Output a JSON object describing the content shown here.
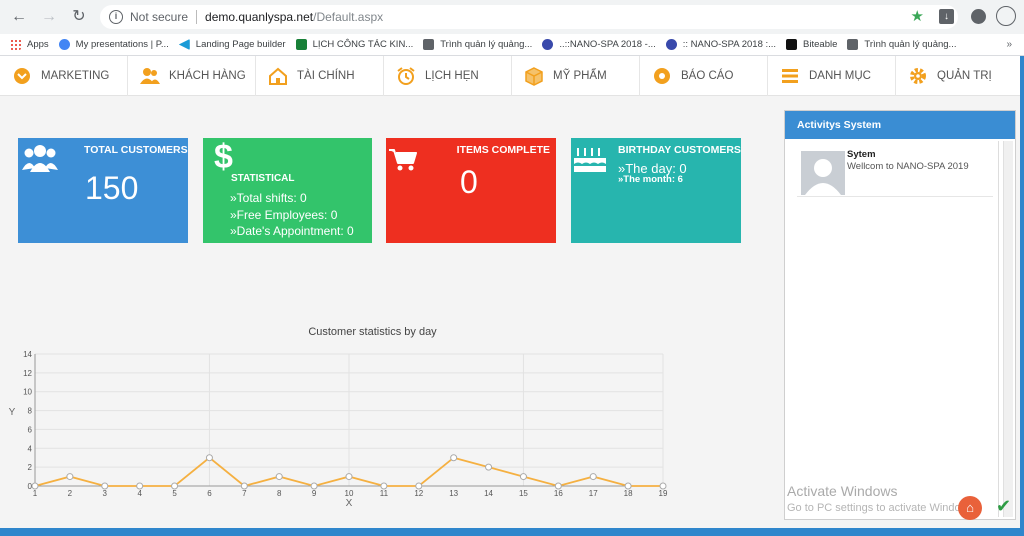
{
  "browser": {
    "security": "Not secure",
    "url_host": "demo.quanlyspa.net",
    "url_path": "/Default.aspx",
    "bookmarks": [
      {
        "label": "Apps",
        "color": "#e94235"
      },
      {
        "label": "My presentations | P...",
        "color": "#4285f4"
      },
      {
        "label": "Landing Page builder",
        "color": "#1a9bd7"
      },
      {
        "label": "LỊCH CÔNG TÁC KIN...",
        "color": "#188038"
      },
      {
        "label": "Trình quản lý quảng...",
        "color": "#5f6368"
      },
      {
        "label": "..::NANO-SPA 2018 -...",
        "color": "#3949ab"
      },
      {
        "label": ":: NANO-SPA 2018 :...",
        "color": "#3949ab"
      },
      {
        "label": "Biteable",
        "color": "#111111"
      },
      {
        "label": "Trình quản lý quảng...",
        "color": "#5f6368"
      }
    ],
    "more": "»"
  },
  "nav": [
    {
      "label": "MARKETING",
      "icon": "marketing-icon",
      "color": "#f2a01e"
    },
    {
      "label": "KHÁCH HÀNG",
      "icon": "customers-icon",
      "color": "#f2a01e"
    },
    {
      "label": "TÀI CHÍNH",
      "icon": "finance-icon",
      "color": "#f2a01e"
    },
    {
      "label": "LỊCH HẸN",
      "icon": "alarm-clock-icon",
      "color": "#f2a01e"
    },
    {
      "label": "MỸ PHẨM",
      "icon": "box-icon",
      "color": "#f2a01e"
    },
    {
      "label": "BÁO CÁO",
      "icon": "report-icon",
      "color": "#f2a01e"
    },
    {
      "label": "DANH MỤC",
      "icon": "list-icon",
      "color": "#f2a01e"
    },
    {
      "label": "QUẢN TRỊ",
      "icon": "gear-icon",
      "color": "#f2a01e"
    }
  ],
  "tiles": {
    "total_customers": {
      "title": "TOTAL CUSTOMERS",
      "value": "150",
      "color": "#3d8fd6"
    },
    "statistical": {
      "title": "STATISTICAL",
      "color": "#33c46b",
      "lines": [
        "»Total shifts: 0",
        "»Free Employees: 0",
        "»Date's Appointment: 0"
      ]
    },
    "items_complete": {
      "title": "ITEMS COMPLETE",
      "value": "0",
      "color": "#ee2f20"
    },
    "birthday": {
      "title": "BIRTHDAY CUSTOMERS",
      "color": "#27b5ae",
      "day": "»The day: 0",
      "month": "»The month: 6"
    }
  },
  "chart_data": {
    "type": "line",
    "title": "Customer statistics by day",
    "xlabel": "X",
    "ylabel": "Y",
    "x": [
      1,
      2,
      3,
      4,
      5,
      6,
      7,
      8,
      9,
      10,
      11,
      12,
      13,
      14,
      15,
      16,
      17,
      18,
      19
    ],
    "values": [
      0,
      1,
      0,
      0,
      0,
      3,
      0,
      1,
      0,
      1,
      0,
      0,
      3,
      2,
      1,
      0,
      1,
      0,
      0
    ],
    "ylim": [
      0,
      14
    ],
    "yticks": [
      0,
      2,
      4,
      6,
      8,
      10,
      12,
      14
    ],
    "grid": true,
    "line_color": "#f5b041"
  },
  "activity": {
    "title": "Activitys System",
    "items": [
      {
        "name": "Sytem",
        "message": "Wellcom to NANO-SPA 2019"
      }
    ]
  },
  "watermark": {
    "line1": "Activate Windows",
    "line2": "Go to PC settings to activate Windows."
  }
}
